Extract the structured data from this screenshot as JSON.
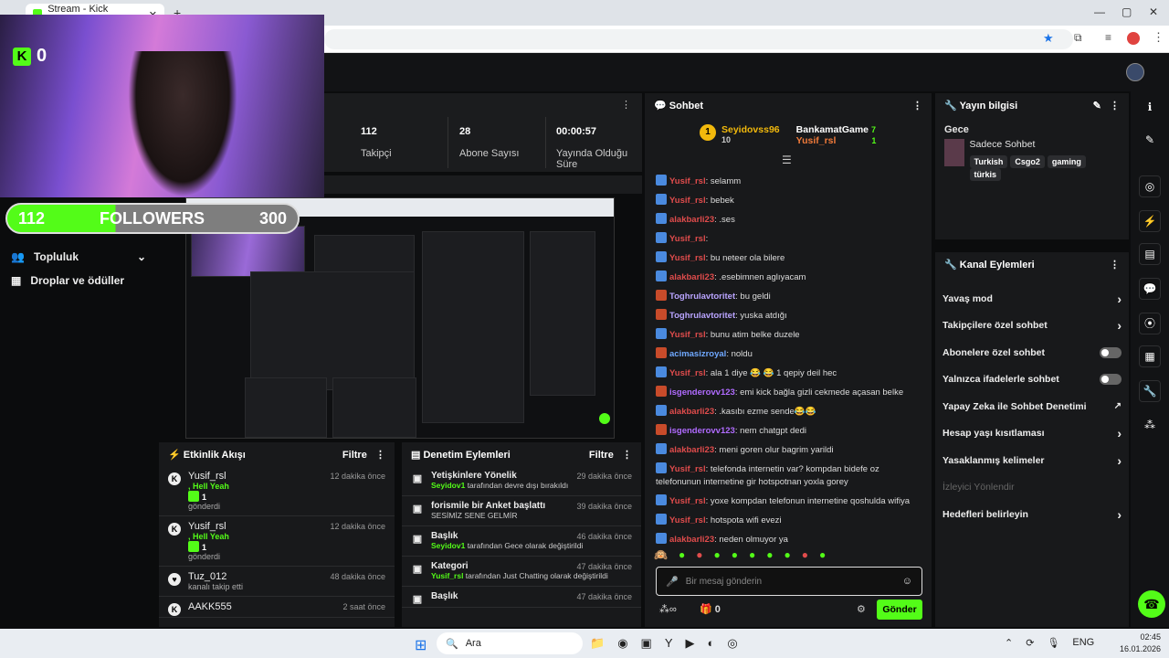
{
  "browser": {
    "tab_title": "Stream - Kick Dashboard",
    "new_tab": "+",
    "minimize": "—",
    "maximize": "▢",
    "close": "✕"
  },
  "overlay": {
    "kick_count": "0",
    "followers_current": "112",
    "followers_label": "FOLLOWERS",
    "followers_goal": "300",
    "follower_progress": 0.373
  },
  "left_menu": [
    {
      "icon": "users-icon",
      "label": "Topluluk"
    },
    {
      "icon": "gift-icon",
      "label": "Droplar ve ödüller"
    }
  ],
  "stats": [
    {
      "value": "112",
      "label": "Takipçi"
    },
    {
      "value": "28",
      "label": "Abone Sayısı"
    },
    {
      "value": "00:00:57",
      "label": "Yayında Olduğu Süre"
    }
  ],
  "activity": {
    "title": "Etkinlik Akışı",
    "filter": "Filtre",
    "items": [
      {
        "name": "Yusif_rsl",
        "time": "12 dakika önce",
        "msg": ", Hell Yeah",
        "count": "1",
        "sub": "gönderdi"
      },
      {
        "name": "Yusif_rsl",
        "time": "12 dakika önce",
        "msg": ", Hell Yeah",
        "count": "1",
        "sub": "gönderdi"
      },
      {
        "name": "Tuz_012",
        "time": "48 dakika önce",
        "msg": "",
        "count": "",
        "sub": "kanalı takip etti"
      },
      {
        "name": "AAKK555",
        "time": "2 saat önce",
        "msg": "",
        "count": "",
        "sub": ""
      }
    ]
  },
  "moderation": {
    "title": "Denetim Eylemleri",
    "filter": "Filtre",
    "items": [
      {
        "title": "Yetişkinlere Yönelik",
        "time": "29 dakika önce",
        "actor": "Seyidov1",
        "detail": " tarafından devre dışı bırakıldı",
        "extra": ""
      },
      {
        "title": "forismile bir Anket başlattı",
        "time": "39 dakika önce",
        "actor": "",
        "detail": "SESİMİZ SENE GELMİR",
        "extra": ""
      },
      {
        "title": "Başlık",
        "time": "46 dakika önce",
        "actor": "Seyidov1",
        "detail": " tarafından Gece olarak değiştirildi",
        "extra": ""
      },
      {
        "title": "Kategori",
        "time": "47 dakika önce",
        "actor": "Yusif_rsl",
        "detail": " tarafından Just Chatting olarak değiştirildi",
        "extra": ""
      },
      {
        "title": "Başlık",
        "time": "47 dakika önce",
        "actor": "",
        "detail": "",
        "extra": ""
      }
    ]
  },
  "chat": {
    "title": "Sohbet",
    "top": [
      {
        "name": "Seyidovss96",
        "count": "10"
      },
      {
        "name": "BankamatGame",
        "count": "7"
      },
      {
        "name": "Yusif_rsl",
        "count": "1"
      }
    ],
    "messages": [
      {
        "user": "Yusif_rsl",
        "color": "#e04c4c",
        "text": ": selamm"
      },
      {
        "user": "Yusif_rsl",
        "color": "#e04c4c",
        "text": ": bebek"
      },
      {
        "user": "alakbarli23",
        "color": "#e04c4c",
        "text": ": .ses"
      },
      {
        "user": "Yusif_rsl",
        "color": "#e04c4c",
        "text": ": "
      },
      {
        "user": "Yusif_rsl",
        "color": "#e04c4c",
        "text": ": bu neteer ola bilere"
      },
      {
        "user": "alakbarli23",
        "color": "#e04c4c",
        "text": ": .esebimnen aglıyacam"
      },
      {
        "user": "Toghrulavtoritet",
        "color": "#b9a4ff",
        "text": ": bu geldi"
      },
      {
        "user": "Toghrulavtoritet",
        "color": "#b9a4ff",
        "text": ": yuska atdığı"
      },
      {
        "user": "Yusif_rsl",
        "color": "#e04c4c",
        "text": ": bunu atim belke duzele"
      },
      {
        "user": "acimasizroyal",
        "color": "#6fa8ff",
        "text": ": noldu"
      },
      {
        "user": "Yusif_rsl",
        "color": "#e04c4c",
        "text": ": ala 1 diye 😂 😂 1 qepiy deil hec"
      },
      {
        "user": "isgenderovv123",
        "color": "#b06bff",
        "text": ": emi kick bağla gizli cekmede açasan belke"
      },
      {
        "user": "alakbarli23",
        "color": "#e04c4c",
        "text": ": .kasıbı ezme sende😂😂"
      },
      {
        "user": "isgenderovv123",
        "color": "#b06bff",
        "text": ": nem chatgpt dedi"
      },
      {
        "user": "alakbarli23",
        "color": "#e04c4c",
        "text": ": meni goren olur bagrim yarildi"
      },
      {
        "user": "Yusif_rsl",
        "color": "#e04c4c",
        "text": ": telefonda internetin var? kompdan bidefe oz telefonunun internetine gir hotspotnan yoxla gorey"
      },
      {
        "user": "Yusif_rsl",
        "color": "#e04c4c",
        "text": ": yoxe kompdan telefonun internetine qoshulda wifiya"
      },
      {
        "user": "Yusif_rsl",
        "color": "#e04c4c",
        "text": ": hotspota wifi evezi"
      },
      {
        "user": "alakbarli23",
        "color": "#e04c4c",
        "text": ": neden olmuyor ya"
      }
    ],
    "placeholder": "Bir mesaj gönderin",
    "points": "0",
    "send": "Gönder"
  },
  "stream_info": {
    "title": "Yayın bilgisi",
    "stream_title": "Gece",
    "category": "Sadece Sohbet",
    "tags": [
      "Turkish",
      "Csgo2",
      "gaming",
      "türkis"
    ]
  },
  "channel_actions": {
    "title": "Kanal Eylemleri",
    "items": [
      {
        "label": "Yavaş mod",
        "kind": "arrow"
      },
      {
        "label": "Takipçilere özel sohbet",
        "kind": "arrow"
      },
      {
        "label": "Abonelere özel sohbet",
        "kind": "toggle"
      },
      {
        "label": "Yalnızca ifadelerle sohbet",
        "kind": "toggle"
      },
      {
        "label": "Yapay Zeka ile Sohbet Denetimi",
        "kind": "link"
      },
      {
        "label": "Hesap yaşı kısıtlaması",
        "kind": "arrow"
      },
      {
        "label": "Yasaklanmış kelimeler",
        "kind": "arrow"
      },
      {
        "label": "İzleyici Yönlendir",
        "kind": "disabled"
      },
      {
        "label": "Hedefleri belirleyin",
        "kind": "arrow"
      }
    ]
  },
  "taskbar": {
    "search": "Ara",
    "lang": "ENG",
    "time": "02:45",
    "date": "16.01.2026"
  }
}
